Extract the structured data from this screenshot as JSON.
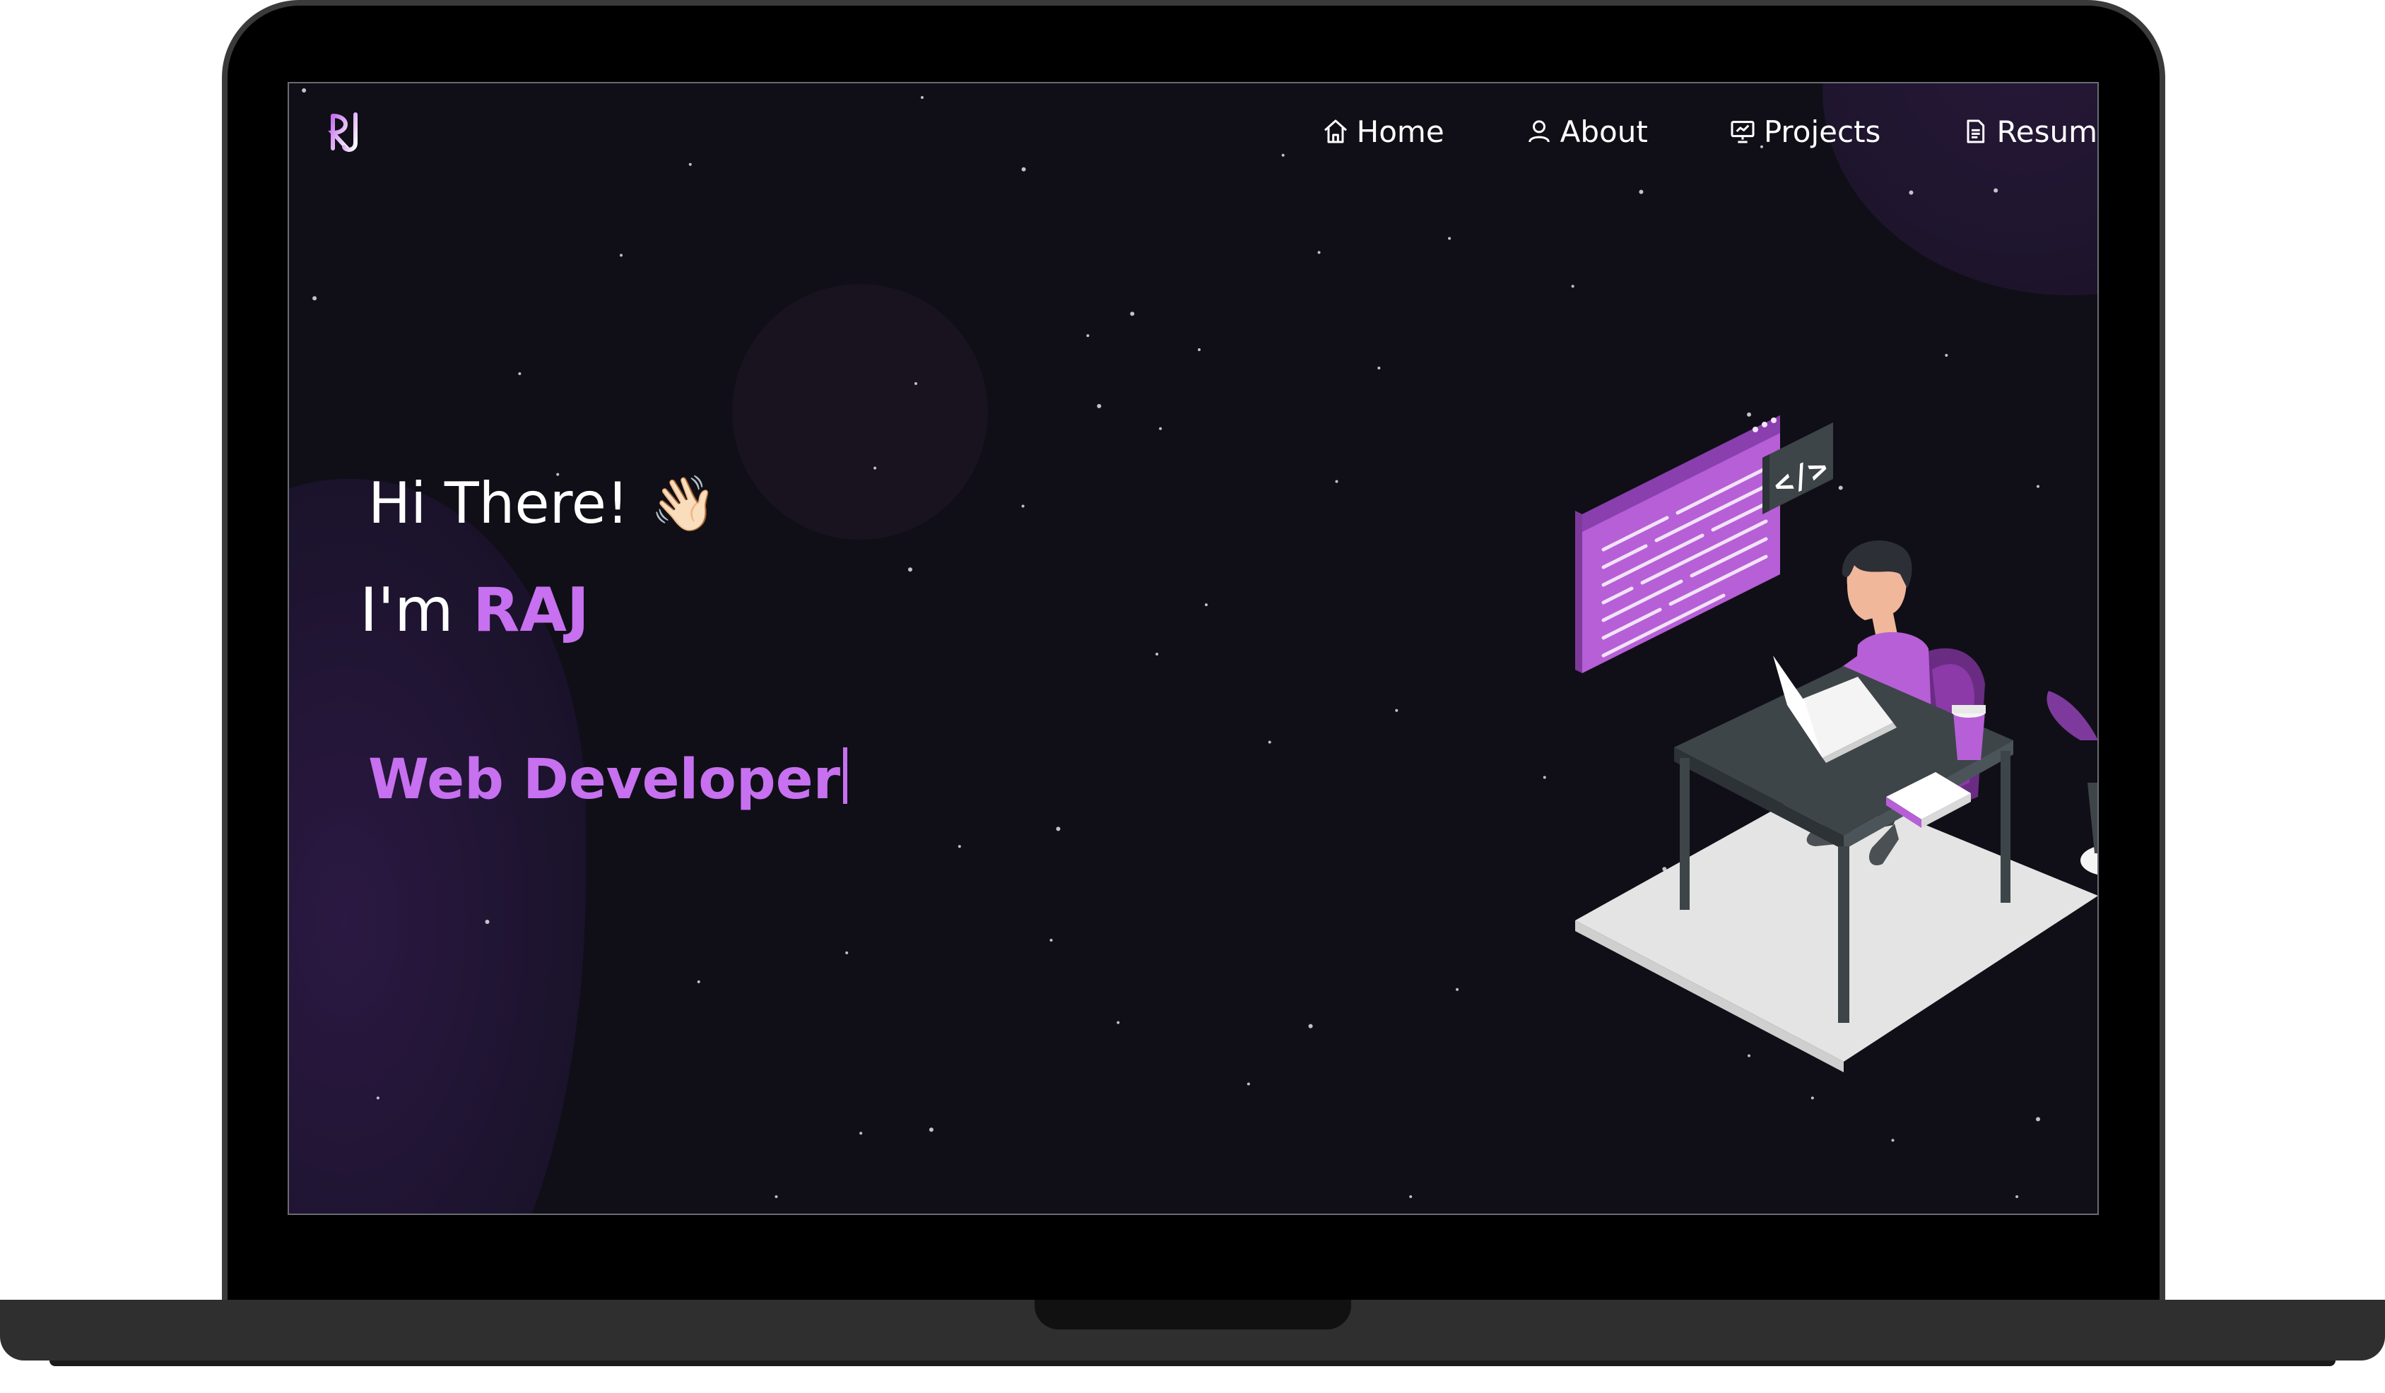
{
  "nav": {
    "items": [
      {
        "label": "Home",
        "icon": "home-icon"
      },
      {
        "label": "About",
        "icon": "user-icon"
      },
      {
        "label": "Projects",
        "icon": "presentation-icon"
      },
      {
        "label": "Resum",
        "icon": "document-icon"
      }
    ]
  },
  "hero": {
    "greeting": "Hi There!",
    "wave_emoji": "👋🏻",
    "intro_prefix": "I'm",
    "name": "RAJ",
    "role": "Web Developer"
  },
  "illustration": {
    "code_tag": "</>"
  },
  "colors": {
    "accent": "#c770f0",
    "background": "#100f17",
    "text": "#ffffff"
  }
}
